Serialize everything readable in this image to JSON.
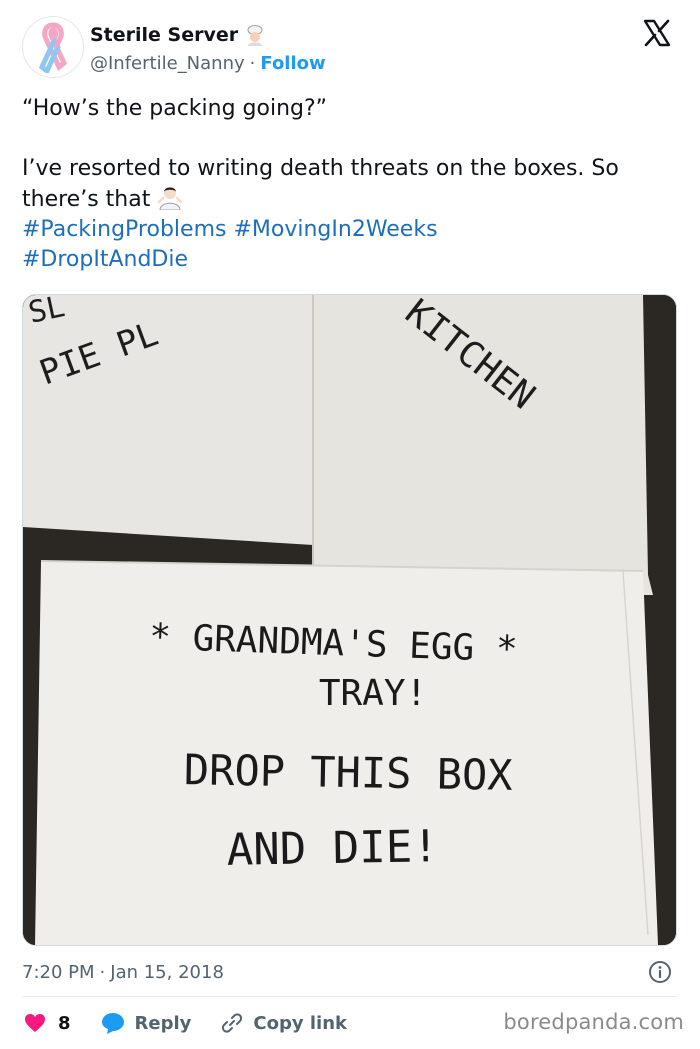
{
  "author": {
    "display_name": "Sterile Server",
    "handle": "@Infertile_Nanny",
    "separator": "·",
    "follow_label": "Follow",
    "avatar_icon": "awareness-ribbon-icon",
    "name_emoji_icon": "chef-emoji-icon"
  },
  "tweet": {
    "text": "“How’s the packing going?”\n\nI’ve resorted to writing death threats on the boxes. So there’s that",
    "emoji_icon": "person-shrugging-emoji-icon",
    "hashtags": [
      "#PackingProblems",
      "#MovingIn2Weeks",
      "#DropItAndDie"
    ]
  },
  "media": {
    "box_labels": {
      "top_left": "PIE PL",
      "top_left_partial": "SL",
      "top_right": "KITCHEN",
      "main_line1": "* GRANDMA'S EGG *",
      "main_line2": "TRAY!",
      "main_line3": "DROP THIS BOX",
      "main_line4": "AND DIE!"
    }
  },
  "meta": {
    "time": "7:20 PM",
    "separator": "·",
    "date": "Jan 15, 2018"
  },
  "actions": {
    "like_count": "8",
    "reply_label": "Reply",
    "copy_link_label": "Copy link"
  },
  "watermark": "boredpanda.com",
  "colors": {
    "link": "#1d9bf0",
    "hashtag": "#1d6fbe",
    "like": "#f91880",
    "muted": "#536471"
  }
}
